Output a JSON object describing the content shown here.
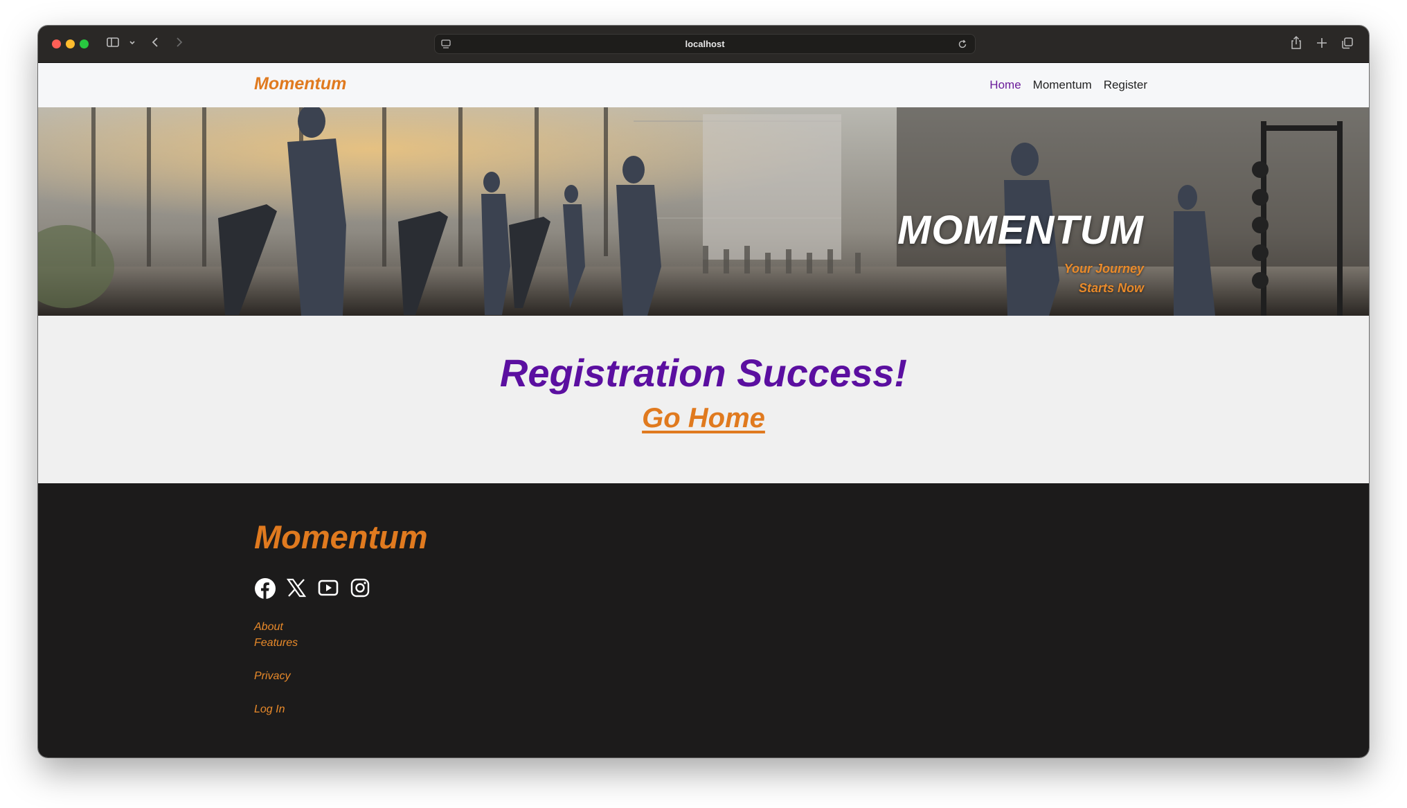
{
  "browser": {
    "url": "localhost"
  },
  "navbar": {
    "brand": "Momentum",
    "links": [
      {
        "label": "Home",
        "active": true
      },
      {
        "label": "Momentum",
        "active": false
      },
      {
        "label": "Register",
        "active": false
      }
    ]
  },
  "hero": {
    "title": "MOMENTUM",
    "tagline_line1": "Your Journey",
    "tagline_line2": "Starts Now"
  },
  "main": {
    "heading": "Registration Success!",
    "link": "Go Home"
  },
  "footer": {
    "brand": "Momentum",
    "social": [
      "facebook-icon",
      "x-icon",
      "youtube-icon",
      "instagram-icon"
    ],
    "links": [
      "About",
      "Features",
      "Privacy",
      "Log In"
    ]
  },
  "colors": {
    "brand_orange": "#e07a1f",
    "accent_purple": "#5b0fa0",
    "footer_bg": "#1c1b1b"
  }
}
